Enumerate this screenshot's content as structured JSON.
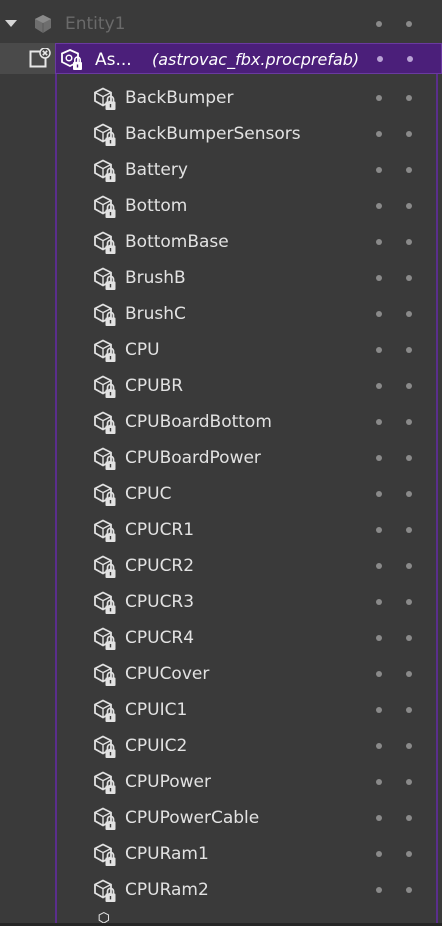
{
  "entity": {
    "label": "Entity1",
    "expander_icon": "triangle-down-icon",
    "icon": "cube-icon"
  },
  "prefab": {
    "name": "As...",
    "source": "(astrovac_fbx.procprefab)",
    "icon": "prefab-lock-icon",
    "edit_icon": "prefab-edit-close-icon",
    "highlight_color": "#4b1f7a",
    "bracket_color": "#5a2e8c"
  },
  "children": [
    {
      "label": "BackBumper"
    },
    {
      "label": "BackBumperSensors"
    },
    {
      "label": "Battery"
    },
    {
      "label": "Bottom"
    },
    {
      "label": "BottomBase"
    },
    {
      "label": "BrushB"
    },
    {
      "label": "BrushC"
    },
    {
      "label": "CPU"
    },
    {
      "label": "CPUBR"
    },
    {
      "label": "CPUBoardBottom"
    },
    {
      "label": "CPUBoardPower"
    },
    {
      "label": "CPUC"
    },
    {
      "label": "CPUCR1"
    },
    {
      "label": "CPUCR2"
    },
    {
      "label": "CPUCR3"
    },
    {
      "label": "CPUCR4"
    },
    {
      "label": "CPUCover"
    },
    {
      "label": "CPUIC1"
    },
    {
      "label": "CPUIC2"
    },
    {
      "label": "CPUPower"
    },
    {
      "label": "CPUPowerCable"
    },
    {
      "label": "CPURam1"
    },
    {
      "label": "CPURam2"
    }
  ],
  "child_icon": "cube-lock-icon",
  "row_controls": [
    "visibility-toggle",
    "lock-toggle"
  ]
}
